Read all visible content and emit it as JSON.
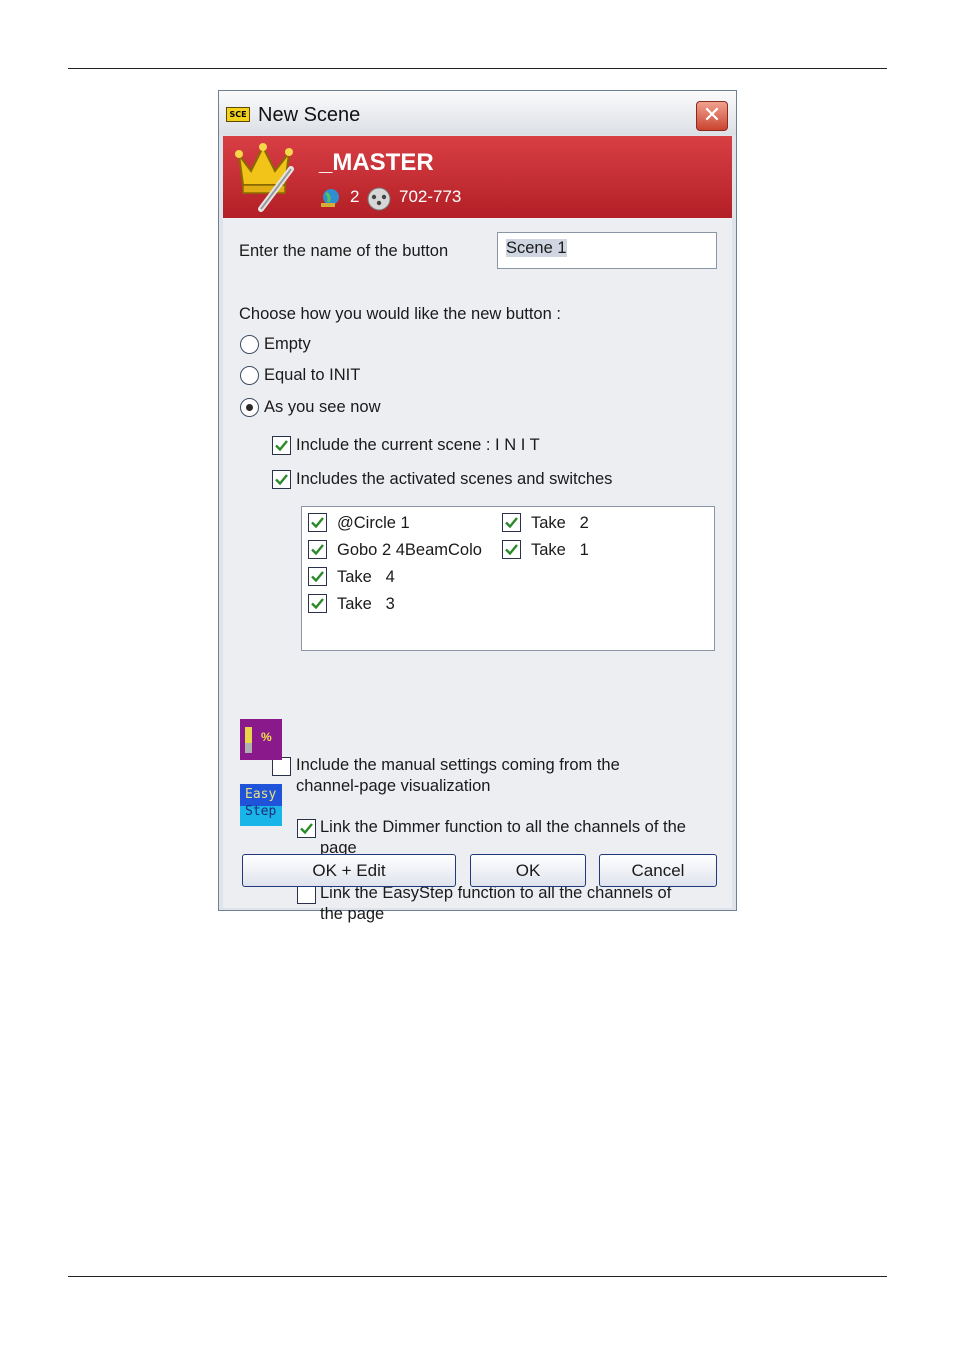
{
  "window": {
    "title": "New Scene",
    "title_icon_text": "SCE",
    "close_glyph": "✕"
  },
  "banner": {
    "name": "_MASTER",
    "universe_count": "2",
    "address_range": "702-773",
    "icons": [
      "crown-icon",
      "globe-icon",
      "dmx-connector-icon"
    ]
  },
  "form": {
    "name_label": "Enter the name of the button",
    "name_value": "Scene 1",
    "choose_label": "Choose how you would like the new button :",
    "options": [
      {
        "label": "Empty",
        "selected": false
      },
      {
        "label": "Equal to INIT",
        "selected": false
      },
      {
        "label": "As you see now",
        "selected": true
      }
    ],
    "include_current": {
      "label": "Include the current scene : I N I T",
      "checked": true
    },
    "include_activated": {
      "label": "Includes the activated scenes and switches",
      "checked": true
    },
    "scenes": [
      {
        "label": "@Circle 1",
        "checked": true
      },
      {
        "label": "Take   2",
        "checked": true
      },
      {
        "label": "Gobo 2 4BeamColo",
        "checked": true
      },
      {
        "label": "Take   1",
        "checked": true
      },
      {
        "label": "Take   4",
        "checked": true
      },
      {
        "label": "Take   3",
        "checked": true
      }
    ],
    "include_manual": {
      "line1": "Include the manual settings coming from the",
      "line2": "channel-page visualization",
      "checked": false
    },
    "link_dimmer": {
      "line1": "Link the Dimmer function to all the channels of the",
      "line2": "page",
      "checked": true
    },
    "link_easystep": {
      "line1": "Link the EasyStep function to all the channels of",
      "line2": "the page",
      "checked": false
    },
    "dimmer_icon_text": "%",
    "easystep_icon_line1": "Easy",
    "easystep_icon_line2": "Step"
  },
  "buttons": {
    "ok_edit": "OK + Edit",
    "ok": "OK",
    "cancel": "Cancel"
  },
  "colors": {
    "banner_red": "#c52c33",
    "dimmer_purple": "#8a1a8c",
    "easystep_blue": "#1f53d9",
    "check_green": "#2a8a2a"
  }
}
